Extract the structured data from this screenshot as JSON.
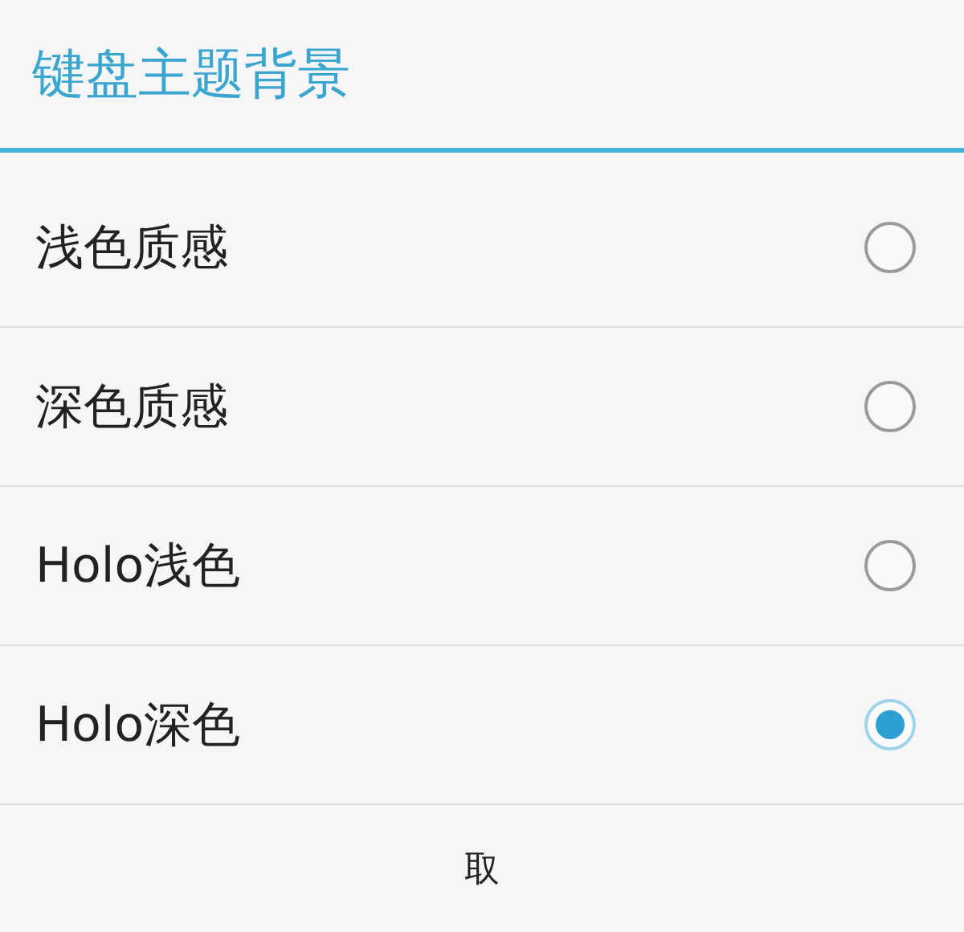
{
  "dialog": {
    "title": "键盘主题背景",
    "options": [
      {
        "label": "浅色质感",
        "selected": false
      },
      {
        "label": "深色质感",
        "selected": false
      },
      {
        "label": "Holo浅色",
        "selected": false
      },
      {
        "label": "Holo深色",
        "selected": true
      }
    ],
    "buttons": [
      "取"
    ]
  }
}
